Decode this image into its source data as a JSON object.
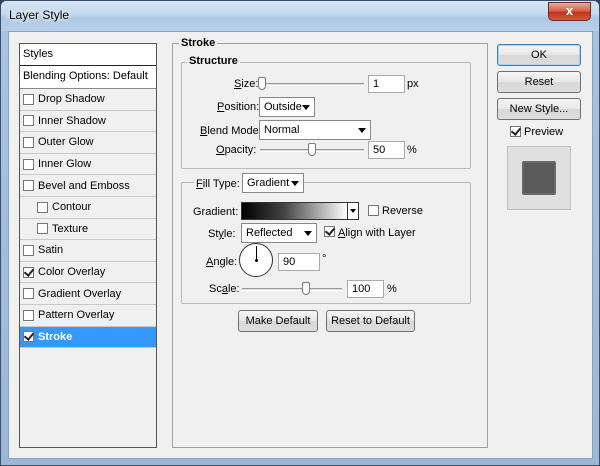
{
  "window": {
    "title": "Layer Style",
    "close": "x"
  },
  "styles_list": {
    "header": "Styles",
    "blending": "Blending Options: Default",
    "items": [
      {
        "label": "Drop Shadow",
        "checked": false,
        "indent": false,
        "selected": false
      },
      {
        "label": "Inner Shadow",
        "checked": false,
        "indent": false,
        "selected": false
      },
      {
        "label": "Outer Glow",
        "checked": false,
        "indent": false,
        "selected": false
      },
      {
        "label": "Inner Glow",
        "checked": false,
        "indent": false,
        "selected": false
      },
      {
        "label": "Bevel and Emboss",
        "checked": false,
        "indent": false,
        "selected": false
      },
      {
        "label": "Contour",
        "checked": false,
        "indent": true,
        "selected": false
      },
      {
        "label": "Texture",
        "checked": false,
        "indent": true,
        "selected": false
      },
      {
        "label": "Satin",
        "checked": false,
        "indent": false,
        "selected": false
      },
      {
        "label": "Color Overlay",
        "checked": true,
        "indent": false,
        "selected": false
      },
      {
        "label": "Gradient Overlay",
        "checked": false,
        "indent": false,
        "selected": false
      },
      {
        "label": "Pattern Overlay",
        "checked": false,
        "indent": false,
        "selected": false
      },
      {
        "label": "Stroke",
        "checked": true,
        "indent": false,
        "selected": true
      }
    ]
  },
  "stroke": {
    "title": "Stroke",
    "structure": "Structure",
    "size_label_u": "S",
    "size_label_rest": "ize:",
    "size_value": "1",
    "size_unit": "px",
    "size_fraction": 0.02,
    "position_label_u": "P",
    "position_label_rest": "osition:",
    "position_value": "Outside",
    "blend_label_u": "B",
    "blend_label_rest": "lend Mode:",
    "blend_value": "Normal",
    "opacity_label_u": "O",
    "opacity_label_rest": "pacity:",
    "opacity_value": "50",
    "opacity_unit": "%",
    "opacity_fraction": 0.5,
    "fill_type_label_u": "F",
    "fill_type_label_rest": "ill Type:",
    "fill_type_value": "Gradient",
    "gradient_label": "Gradient:",
    "reverse_label": "Reverse",
    "reverse_checked": false,
    "style_label_pre": "St",
    "style_label_u": "y",
    "style_label_rest": "le:",
    "style_value": "Reflected",
    "align_label_u": "A",
    "align_label_rest": "lign with Layer",
    "align_checked": true,
    "angle_label_u": "A",
    "angle_label_rest": "ngle:",
    "angle_value": "90",
    "angle_unit": "°",
    "scale_label_pre": "Sc",
    "scale_label_u": "a",
    "scale_label_rest": "le:",
    "scale_value": "100",
    "scale_unit": "%",
    "scale_fraction": 0.64,
    "make_default": "Make Default",
    "reset_default": "Reset to Default"
  },
  "right_panel": {
    "ok": "OK",
    "reset": "Reset",
    "new_style": "New Style...",
    "preview_label": "Preview",
    "preview_checked": true,
    "preview_swatch_color": "#5a5a5a"
  }
}
